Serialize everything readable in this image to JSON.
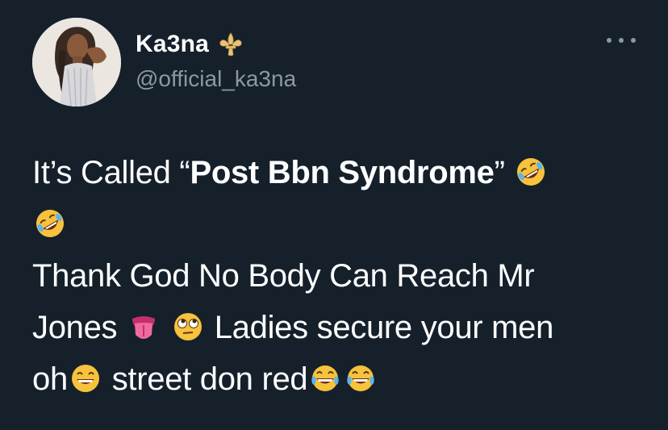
{
  "author": {
    "display_name": "Ka3na",
    "handle": "@official_ka3na",
    "badge_icon": "fleur-de-lis-icon",
    "avatar_icon": "profile-photo"
  },
  "menu": {
    "icon": "more-options-icon"
  },
  "tweet": {
    "line1_pre": "It’s Called “",
    "line1_bold": "Post Bbn Syndrome",
    "line1_post": "”",
    "line3": "Thank God No Body Can Reach Mr",
    "line4_a": "Jones",
    "line4_b": "Ladies secure your men",
    "line5_a": "oh",
    "line5_b": "street don red",
    "emojis": [
      "rofl-emoji",
      "tongue-emoji",
      "eye-roll-emoji",
      "grin-emoji",
      "tears-of-joy-emoji"
    ]
  },
  "colors": {
    "background": "#15202b",
    "primary_text": "#ffffff",
    "secondary_text": "#8b98a5",
    "badge": "#e8c37a"
  }
}
